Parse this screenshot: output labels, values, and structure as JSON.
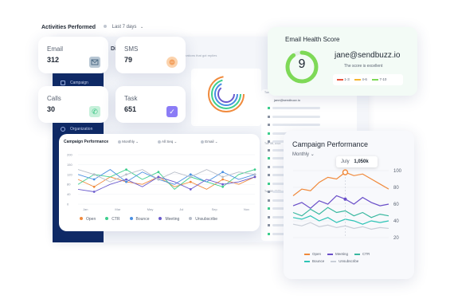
{
  "header": {
    "title": "Activities Performed",
    "period": "Last 7 days",
    "period_chevron_icon": "chevron-down-icon"
  },
  "stats": [
    {
      "label": "Email",
      "value": "312",
      "icon": "envelope-icon",
      "color": "#7f9bb3"
    },
    {
      "label": "SMS",
      "value": "79",
      "icon": "chat-bubble-icon",
      "color": "#f4a261"
    },
    {
      "label": "Calls",
      "value": "30",
      "icon": "phone-icon",
      "color": "#2ec27e"
    },
    {
      "label": "Task",
      "value": "651",
      "icon": "checkbox-icon",
      "color": "#8b7cf6"
    }
  ],
  "sidebar": {
    "items": [
      {
        "label": "Campaign",
        "icon": "campaign-icon"
      },
      {
        "label": "Organization",
        "icon": "organization-icon"
      }
    ]
  },
  "background": {
    "partial_title": "Di",
    "subtitle_fragment": "rations that got replies"
  },
  "email_health": {
    "title": "Email Health Score",
    "score": "9",
    "email": "jane@sendbuzz.io",
    "status": "The score is excellent",
    "score_fraction": 0.9,
    "legend": [
      {
        "label": "1-3",
        "color": "#e8553e"
      },
      {
        "label": "4-6",
        "color": "#f5b731"
      },
      {
        "label": "7-10",
        "color": "#7ed957"
      }
    ]
  },
  "campaign_left": {
    "title": "Campaign Performance",
    "filters": [
      "Monthly",
      "All Seq",
      "Email"
    ],
    "chart_data": {
      "type": "line",
      "x": [
        "Jan",
        "Mar",
        "May",
        "Jul",
        "Sep",
        "Nov"
      ],
      "y_ticks": [
        "200",
        "150",
        "120",
        "80",
        "40",
        "0"
      ],
      "ylim": [
        0,
        200
      ],
      "series": [
        {
          "name": "Open",
          "color": "#f08a3c",
          "values": [
            100,
            70,
            110,
            90,
            80,
            110,
            70,
            90,
            60,
            100,
            80,
            110
          ]
        },
        {
          "name": "CTR",
          "color": "#3ecf8e",
          "values": [
            80,
            120,
            110,
            140,
            100,
            130,
            60,
            110,
            90,
            70,
            120,
            140
          ]
        },
        {
          "name": "Bounce",
          "color": "#4a90e2",
          "values": [
            120,
            100,
            140,
            90,
            130,
            100,
            80,
            120,
            90,
            130,
            100,
            120
          ]
        },
        {
          "name": "Meeting",
          "color": "#6a5acd",
          "values": [
            60,
            50,
            80,
            100,
            70,
            110,
            90,
            60,
            100,
            80,
            90,
            110
          ]
        },
        {
          "name": "Unsubscribe",
          "color": "#b8bec9",
          "values": [
            140,
            120,
            90,
            120,
            140,
            100,
            130,
            110,
            140,
            110,
            130,
            120
          ]
        }
      ]
    }
  },
  "campaign_right": {
    "title": "Campaign Performance",
    "period": "Monthly",
    "tooltip": {
      "label": "July",
      "value": "1,050k"
    },
    "chart_data": {
      "type": "line",
      "y_ticks": [
        "100",
        "80",
        "60",
        "40",
        "20"
      ],
      "ylim": [
        20,
        100
      ],
      "series": [
        {
          "name": "Open",
          "color": "#f08a3c",
          "values": [
            70,
            78,
            76,
            86,
            92,
            90,
            98,
            94,
            96,
            90,
            84,
            78
          ]
        },
        {
          "name": "Meeting",
          "color": "#6a4fc9",
          "values": [
            58,
            62,
            55,
            64,
            60,
            70,
            66,
            60,
            68,
            62,
            58,
            60
          ]
        },
        {
          "name": "CTR",
          "color": "#3ab8a0",
          "values": [
            50,
            46,
            54,
            48,
            56,
            50,
            52,
            46,
            50,
            44,
            48,
            46
          ]
        },
        {
          "name": "Bounce",
          "color": "#2ec4b6",
          "values": [
            44,
            42,
            46,
            40,
            44,
            38,
            42,
            40,
            36,
            40,
            38,
            40
          ]
        },
        {
          "name": "Unsubscribe",
          "color": "#c9ced8",
          "values": [
            36,
            34,
            38,
            33,
            35,
            32,
            34,
            31,
            33,
            30,
            32,
            31
          ]
        }
      ]
    }
  },
  "activity_list": {
    "email": "jane@sendbuzz.io",
    "dates": [
      "Tue 03, 2022",
      "Tue 08, 2022",
      "Tue 09, 2022"
    ]
  }
}
